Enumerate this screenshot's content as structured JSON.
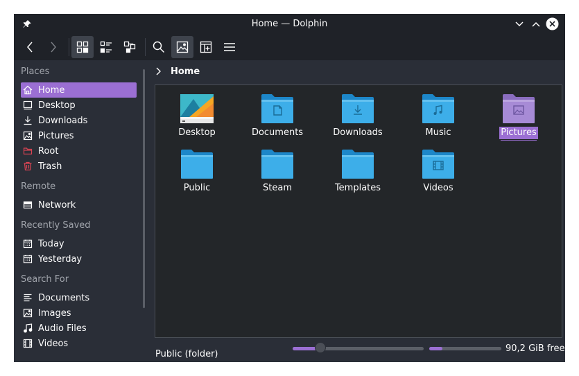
{
  "window": {
    "title": "Home — Dolphin"
  },
  "sidebar": {
    "places_label": "Places",
    "places": [
      {
        "label": "Home",
        "icon": "home-icon"
      },
      {
        "label": "Desktop",
        "icon": "desktop-icon"
      },
      {
        "label": "Downloads",
        "icon": "download-icon"
      },
      {
        "label": "Pictures",
        "icon": "image-icon"
      },
      {
        "label": "Root",
        "icon": "folder-red-icon"
      },
      {
        "label": "Trash",
        "icon": "trash-icon"
      }
    ],
    "remote_label": "Remote",
    "remote": [
      {
        "label": "Network",
        "icon": "network-icon"
      }
    ],
    "recent_label": "Recently Saved",
    "recent": [
      {
        "label": "Today",
        "icon": "calendar-icon"
      },
      {
        "label": "Yesterday",
        "icon": "calendar-icon"
      }
    ],
    "search_label": "Search For",
    "search": [
      {
        "label": "Documents",
        "icon": "document-icon"
      },
      {
        "label": "Images",
        "icon": "image-icon"
      },
      {
        "label": "Audio Files",
        "icon": "music-icon"
      },
      {
        "label": "Videos",
        "icon": "video-icon"
      }
    ]
  },
  "breadcrumb": {
    "current": "Home"
  },
  "files": [
    {
      "name": "Desktop",
      "type": "desktop"
    },
    {
      "name": "Documents",
      "type": "documents"
    },
    {
      "name": "Downloads",
      "type": "downloads"
    },
    {
      "name": "Music",
      "type": "music"
    },
    {
      "name": "Pictures",
      "type": "pictures",
      "selected": true
    },
    {
      "name": "Public",
      "type": "plain"
    },
    {
      "name": "Steam",
      "type": "plain"
    },
    {
      "name": "Templates",
      "type": "plain"
    },
    {
      "name": "Videos",
      "type": "videos"
    }
  ],
  "status": {
    "text": "Public (folder)",
    "zoom_fraction": 0.21,
    "space_used_fraction": 0.18,
    "free_space": "90,2 GiB free"
  },
  "colors": {
    "accent": "#9b6fd3",
    "folder_blue": "#3daee9",
    "folder_blue_dark": "#1d99f3",
    "folder_purple": "#a78bd6"
  }
}
